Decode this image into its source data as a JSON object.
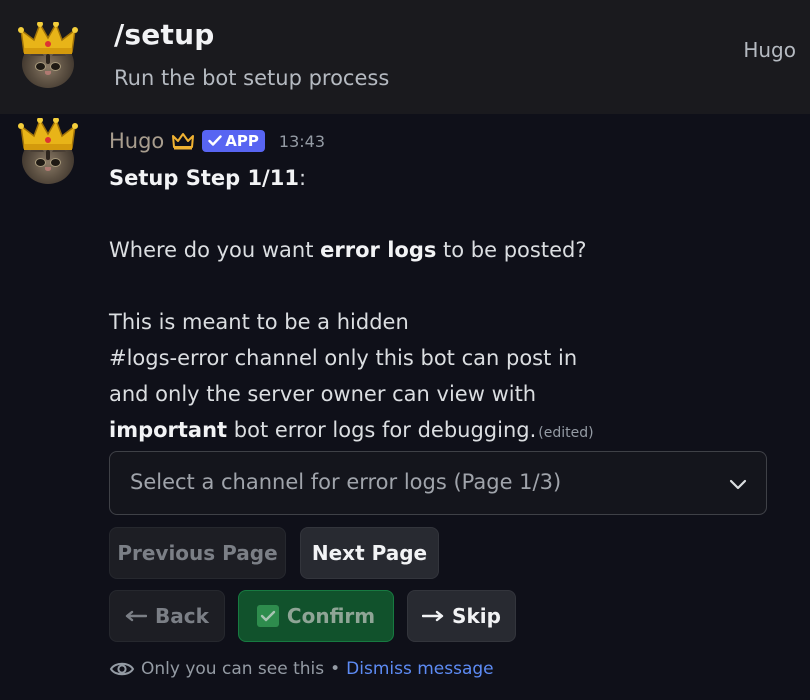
{
  "command": {
    "name": "/setup",
    "description": "Run the bot setup process",
    "user": "Hugo",
    "avatar_icon": "crowned-cat-icon"
  },
  "message": {
    "author": "Hugo",
    "author_color": "#a89d8e",
    "badge": "APP",
    "badge_color": "#5865f2",
    "timestamp": "13:43",
    "step_title": "Setup Step 1/11",
    "step_suffix": ":",
    "question_pre": "Where do you want ",
    "question_bold": "error logs",
    "question_post": " to be posted?",
    "desc_line1": "This is meant to be a hidden",
    "desc_line2": "#logs-error channel only this bot can post in",
    "desc_line3": "and only the server owner can view with",
    "desc_line4_bold": "important",
    "desc_line4_rest": " bot error logs for debugging.",
    "edited": "(edited)"
  },
  "select": {
    "placeholder": "Select a channel for error logs (Page 1/3)"
  },
  "buttons": {
    "previous_page": "Previous Page",
    "next_page": "Next Page",
    "back": "Back",
    "confirm": "Confirm",
    "skip": "Skip"
  },
  "ephemeral": {
    "notice": "Only you can see this",
    "separator": "•",
    "dismiss": "Dismiss message"
  },
  "colors": {
    "background": "#0f1019",
    "header": "#1a1a1e",
    "link": "#5d8bf4",
    "success": "#11522c"
  }
}
